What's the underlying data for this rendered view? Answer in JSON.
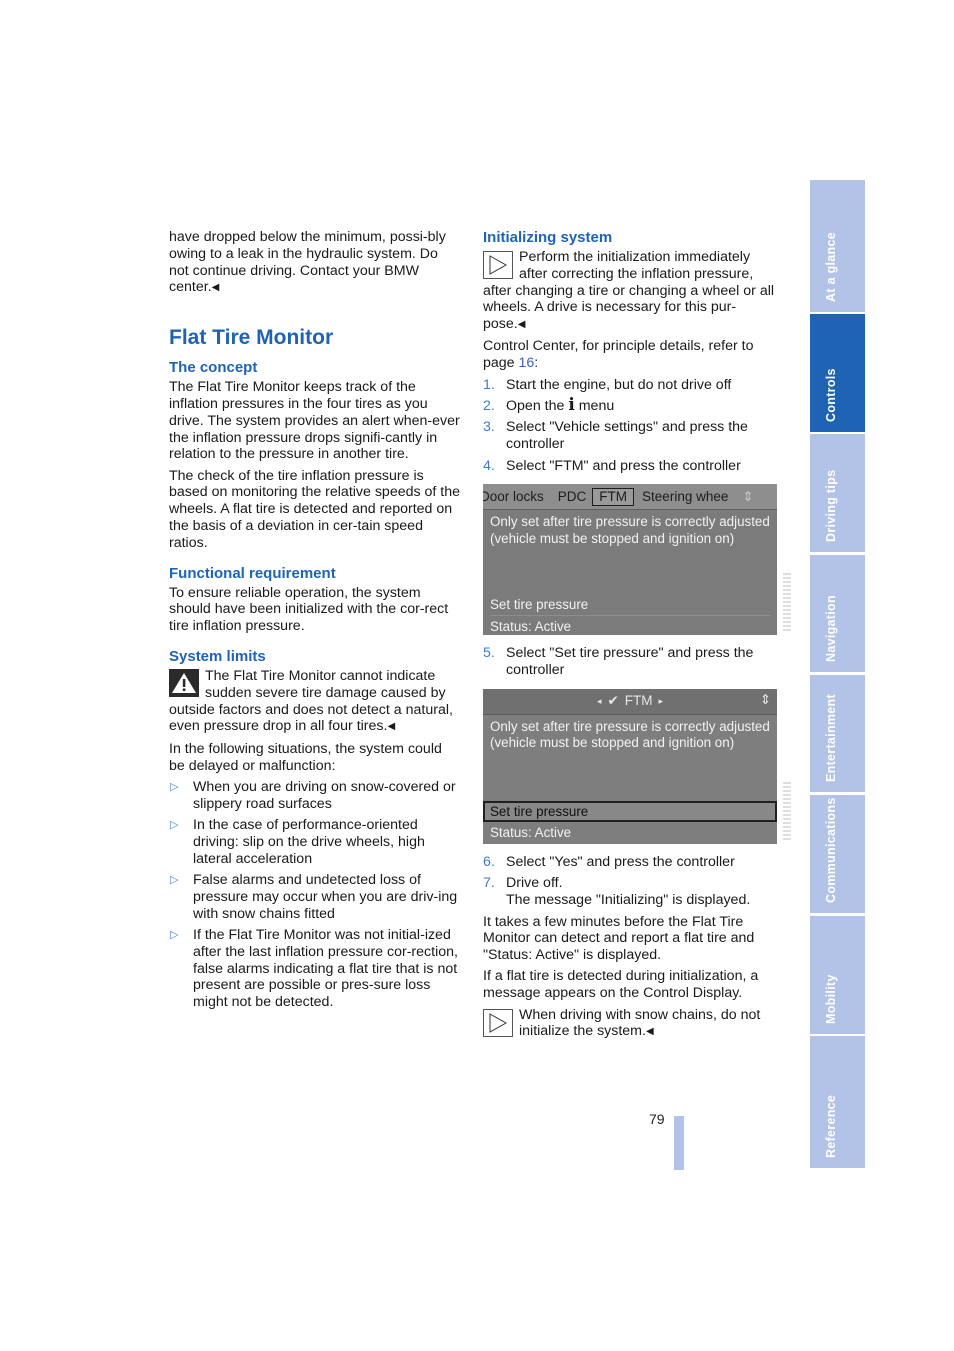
{
  "left": {
    "intro_text": "have dropped below the minimum, possi-bly owing to a leak in the hydraulic system. Do not continue driving. Contact your BMW center.",
    "title": "Flat Tire Monitor",
    "concept": {
      "heading": "The concept",
      "p1": "The Flat Tire Monitor keeps track of the inflation pressures in the four tires as you drive. The system provides an alert when-ever the inflation pressure drops signifi-cantly in relation to the pressure in another tire.",
      "p2": "The check of the tire inflation pressure is based on monitoring the relative speeds of the wheels. A flat tire is detected and reported on the basis of a deviation in cer-tain speed ratios."
    },
    "functional": {
      "heading": "Functional requirement",
      "p1": "To ensure reliable operation, the system should have been initialized with the cor-rect tire inflation pressure."
    },
    "limits": {
      "heading": "System limits",
      "warning": "The Flat Tire Monitor cannot indicate sudden severe tire damage caused by outside factors and does not detect a natural, even pressure drop in all four tires.",
      "intro": "In the following situations, the system could be delayed or malfunction:",
      "bullets": [
        "When you are driving on snow-covered or slippery road surfaces",
        "In the case of performance-oriented driving: slip on the drive wheels, high lateral acceleration",
        "False alarms and undetected loss of pressure may occur when you are driv-ing with snow chains fitted",
        "If the Flat Tire Monitor was not initial-ized after the last inflation pressure cor-rection, false alarms indicating a flat tire that is not present are possible or pres-sure loss might not be detected."
      ]
    }
  },
  "right": {
    "heading": "Initializing system",
    "note1": "Perform the initialization immediately after correcting the inflation pressure, after changing a tire or changing a wheel or all wheels. A drive is necessary for this pur-pose.",
    "control_center_text": "Control Center, for principle details, refer to page ",
    "control_center_page": "16",
    "control_center_suffix": ":",
    "steps_a": [
      {
        "num": "1.",
        "text": "Start the engine, but do not drive off"
      },
      {
        "num": "2.",
        "text_before": "Open the ",
        "icon": "info-icon",
        "text_after": " menu"
      },
      {
        "num": "3.",
        "text": "Select \"Vehicle settings\" and press the controller"
      },
      {
        "num": "4.",
        "text": "Select \"FTM\" and press the controller"
      }
    ],
    "screen1": {
      "tabs": [
        "Door locks",
        "PDC",
        "FTM",
        "Steering whee"
      ],
      "selected_tab": "FTM",
      "message": "Only set after tire pressure is correctly adjusted (vehicle must be stopped and ignition on)",
      "menu_item": "Set tire pressure",
      "status": "Status: Active"
    },
    "step5": {
      "num": "5.",
      "text": "Select \"Set tire pressure\" and press the controller"
    },
    "screen2": {
      "header": "FTM",
      "message": "Only set after tire pressure is correctly adjusted (vehicle must be stopped and ignition on)",
      "menu_item": "Set tire pressure",
      "status": "Status:  Active"
    },
    "steps_b": [
      {
        "num": "6.",
        "text": "Select \"Yes\" and press the controller"
      },
      {
        "num": "7.",
        "text": "Drive off.",
        "text2": "The message \"Initializing\" is displayed."
      }
    ],
    "p_minutes": "It takes a few minutes before the Flat Tire Monitor can detect and report a flat tire and \"Status: Active\" is displayed.",
    "p_flat": "If a flat tire is detected during initialization, a message appears on the Control Display.",
    "note2": "When driving with snow chains, do not initialize the system."
  },
  "side_tabs": [
    {
      "label": "At a glance",
      "active": false
    },
    {
      "label": "Controls",
      "active": true
    },
    {
      "label": "Driving tips",
      "active": false
    },
    {
      "label": "Navigation",
      "active": false
    },
    {
      "label": "Entertainment",
      "active": false
    },
    {
      "label": "Communications",
      "active": false
    },
    {
      "label": "Mobility",
      "active": false
    },
    {
      "label": "Reference",
      "active": false
    }
  ],
  "page_number": "79",
  "colors": {
    "accent_blue": "#1f63b5",
    "side_tab_inactive": "#b3c3e8",
    "bullet_blue": "#4a86c8"
  }
}
